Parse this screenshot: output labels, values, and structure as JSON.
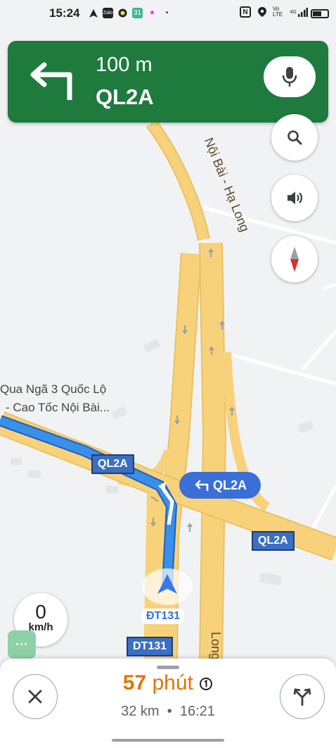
{
  "status_bar": {
    "time": "15:24",
    "left_icons": [
      "navigation-icon",
      "zalo-icon",
      "app-icon",
      "calendar-icon",
      "star-app-icon",
      "dot-icon"
    ],
    "right_icons": [
      "nfc-icon",
      "location-icon",
      "volte-icon",
      "signal-4g-icon",
      "battery-icon"
    ],
    "volte": "Vo LTE",
    "network": "4G"
  },
  "nav_banner": {
    "distance": "100 m",
    "street": "QL2A",
    "maneuver": "turn-left",
    "color": "#1f7a3e"
  },
  "map": {
    "road_label_top": "Nội Bài - Hạ Long",
    "road_label_bottom": "Long",
    "place_label_line1": "Qua Ngã 3 Quốc Lộ",
    "place_label_line2": "- Cao Tốc Nội Bài...",
    "shields": [
      "QL2A",
      "QL2A",
      "DT131"
    ],
    "turn_callout": "QL2A",
    "current_road": "ĐT131"
  },
  "speed": {
    "value": "0",
    "unit": "km/h"
  },
  "bottom_sheet": {
    "eta_minutes": "57",
    "eta_unit": "phút",
    "distance": "32 km",
    "separator": "•",
    "arrival_time": "16:21"
  },
  "colors": {
    "route": "#3a8fe8",
    "road": "#f7d27a",
    "eta": "#e37400"
  }
}
